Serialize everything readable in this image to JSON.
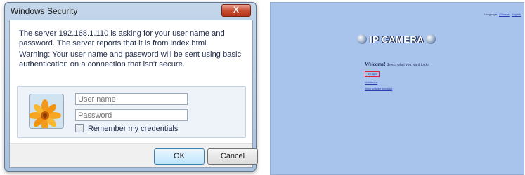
{
  "dialog": {
    "title": "Windows Security",
    "close_label": "X",
    "message_1": "The server 192.168.1.110 is asking for your user name and password. The server reports that it is from index.html.",
    "message_2": "Warning: Your user name and password will be sent using basic authentication on a connection that isn't secure.",
    "username": {
      "value": "",
      "placeholder": "User name"
    },
    "password": {
      "value": "",
      "placeholder": "Password"
    },
    "remember_label": "Remember my credentials",
    "remember_checked": false,
    "ok_label": "OK",
    "cancel_label": "Cancel",
    "avatar_icon": "flower-user-tile-icon",
    "colors": {
      "frame": "#b3c9e3",
      "close_button": "#c74a2f"
    }
  },
  "camera_page": {
    "language_label": "Language",
    "language_links": [
      "Chinese",
      "English"
    ],
    "logo_text": "IP CAMERA",
    "logo_icon": "globe-icon",
    "welcome_title": "Welcome!",
    "welcome_text": "Select what you want to do:",
    "links": [
      "IE Login",
      "Mobile view",
      "Setup software download"
    ],
    "colors": {
      "background": "#a9c4ec",
      "highlight_box": "#d8273a"
    }
  }
}
